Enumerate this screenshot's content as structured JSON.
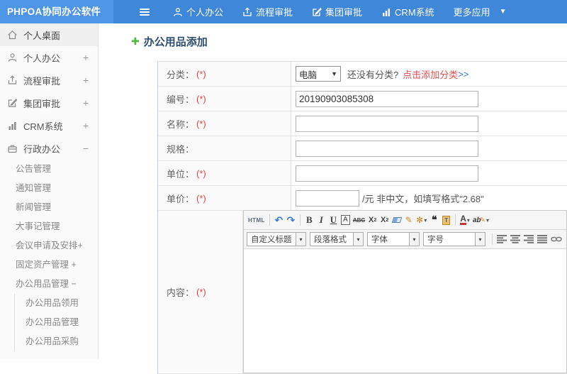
{
  "app": {
    "title": "PHPOA协同办公软件"
  },
  "colors": {
    "topbar": "#3f87d9",
    "logo_bg": "#4e95e6",
    "title_text": "#2f4e6e",
    "required_red": "#e24545",
    "link_red": "#e14c4c",
    "link_blue": "#2b7bd3",
    "plus_green": "#53b43f"
  },
  "topnav": {
    "items": [
      {
        "label": "个人办公",
        "icon": "user-icon"
      },
      {
        "label": "流程审批",
        "icon": "approve-flow-icon"
      },
      {
        "label": "集团审批",
        "icon": "edit-square-icon"
      },
      {
        "label": "CRM系统",
        "icon": "bar-chart-icon"
      },
      {
        "label": "更多应用",
        "icon": "caret-down-icon"
      }
    ],
    "caret": "▼"
  },
  "sidebar": {
    "items": [
      {
        "label": "个人桌面",
        "icon": "home-icon",
        "expander": ""
      },
      {
        "label": "个人办公",
        "icon": "user-icon",
        "expander": "+"
      },
      {
        "label": "流程审批",
        "icon": "approve-flow-icon",
        "expander": "+"
      },
      {
        "label": "集团审批",
        "icon": "edit-square-icon",
        "expander": "+"
      },
      {
        "label": "CRM系统",
        "icon": "bar-chart-icon",
        "expander": "+"
      },
      {
        "label": "行政办公",
        "icon": "briefcase-icon",
        "expander": "−"
      }
    ],
    "admin_children": [
      "公告管理",
      "通知管理",
      "新闻管理",
      "大事记管理",
      "会议申请及安排+",
      "固定资产管理 +",
      "办公用品管理 −"
    ],
    "supplies_children": [
      "办公用品领用",
      "办公用品管理",
      "办公用品采购"
    ]
  },
  "page": {
    "title": "办公用品添加"
  },
  "form": {
    "required_mark": "(*)",
    "rows": {
      "category": {
        "label": "分类："
      },
      "code": {
        "label": "编号："
      },
      "name": {
        "label": "名称："
      },
      "spec": {
        "label": "规格："
      },
      "unit": {
        "label": "单位："
      },
      "price": {
        "label": "单价："
      },
      "content": {
        "label": "内容："
      }
    },
    "category": {
      "selected": "电脑",
      "caret": "▼",
      "hint": "还没有分类?",
      "link": "点击添加分类",
      "link_arrows": ">>"
    },
    "code_value": "20190903085308",
    "price_suffix": "/元 非中文，如填写格式\"2.68\""
  },
  "editor": {
    "source_label": "HTML",
    "bold": "B",
    "italic": "I",
    "underline": "U",
    "font_box": "A",
    "strike": "ABC",
    "quote": "❝",
    "paste_letter": "T",
    "font_color_letter": "A",
    "highlight_letters": "ab",
    "dropdowns": [
      "自定义标题",
      "段落格式",
      "字体",
      "字号"
    ]
  }
}
